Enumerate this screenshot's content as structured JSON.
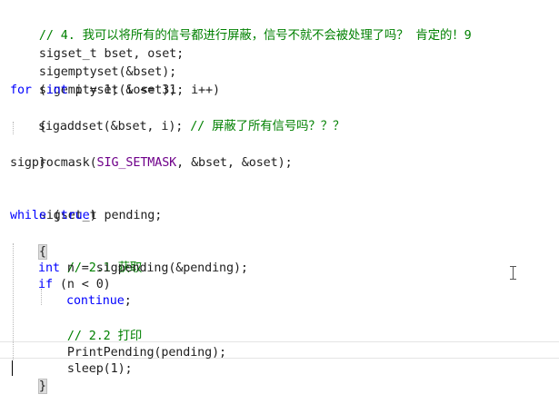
{
  "code": {
    "l1": "// 4. 我可以将所有的信号都进行屏蔽，信号不就不会被处理了吗？ 肯定的！9",
    "l2": "sigset_t bset, oset;",
    "l3": "sigemptyset(&bset);",
    "l4": "sigemptyset(&oset);",
    "l5_kw_for": "for",
    "l5_p1": " (",
    "l5_kw_int": "int",
    "l5_rest": " i = 1; i <= 31; i++)",
    "l6": "{",
    "l7_code": "sigaddset(&bset, i); ",
    "l7_comment": "// 屏蔽了所有信号吗？？？",
    "l8": "}",
    "l9_fn": "sigprocmask(",
    "l9_macro": "SIG_SETMASK",
    "l9_rest": ", &bset, &oset);",
    "l11": "sigset_t pending;",
    "l12_kw_while": "while",
    "l12_p1": " (",
    "l12_kw_true": "true",
    "l12_p2": ")",
    "l13": "{",
    "l14_comment": "// 2.1 获取",
    "l15_kw_int": "int",
    "l15_rest": " n = sigpending(&pending);",
    "l16_kw_if": "if",
    "l16_rest": " (n < 0)",
    "l17_kw_continue": "continue",
    "l17_rest": ";",
    "l18_comment": "// 2.2 打印",
    "l19": "PrintPending(pending);",
    "l20": "sleep(1);",
    "l21": "}"
  },
  "colors": {
    "keyword": "#0000ff",
    "comment": "#008000",
    "macro": "#6f008a",
    "text": "#1e1e1e"
  },
  "icons": {
    "cursor": "i-beam-cursor-icon"
  }
}
